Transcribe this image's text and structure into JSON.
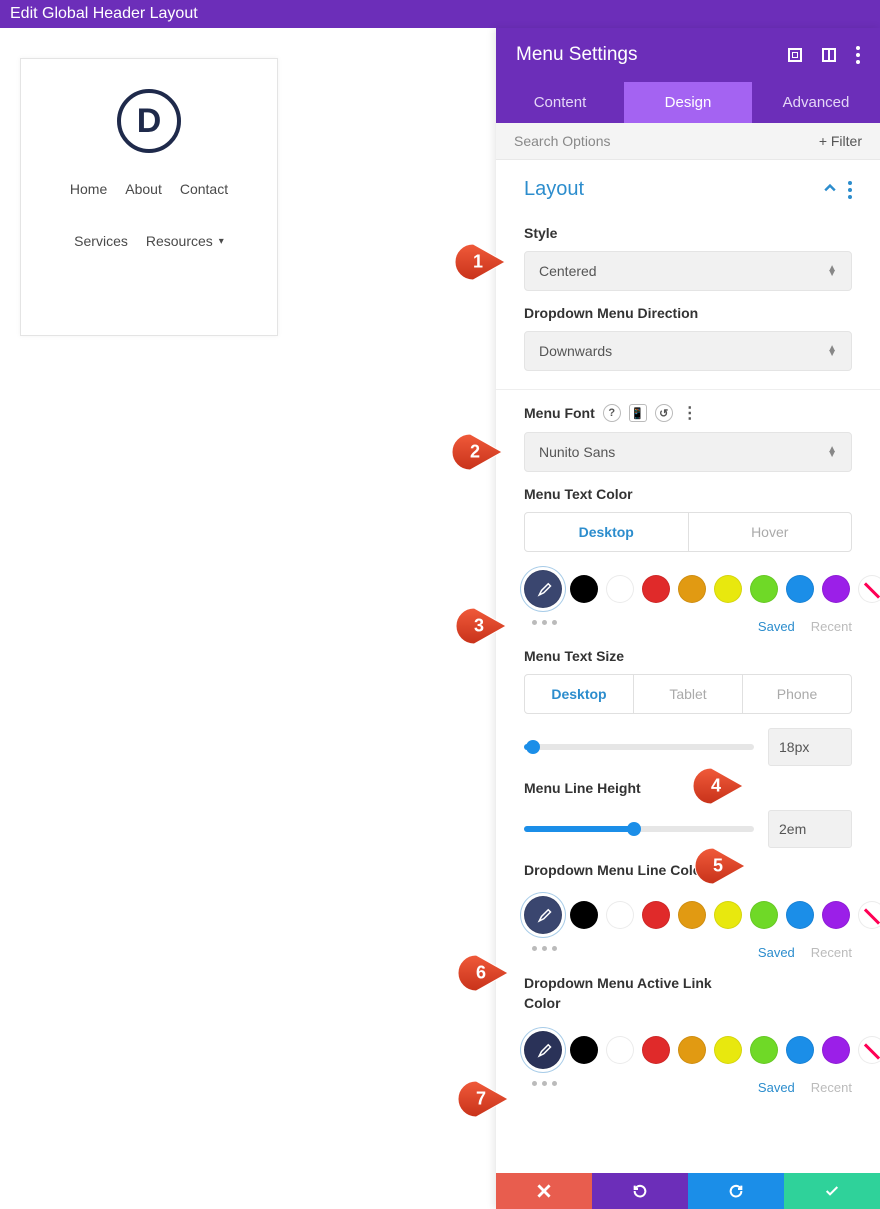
{
  "topbar": {
    "title": "Edit Global Header Layout"
  },
  "preview": {
    "logo_letter": "D",
    "menu": [
      "Home",
      "About",
      "Contact",
      "Services",
      "Resources"
    ]
  },
  "panel": {
    "title": "Menu Settings",
    "tabs": {
      "content": "Content",
      "design": "Design",
      "advanced": "Advanced"
    },
    "filter": {
      "search": "Search Options",
      "btn": "+  Filter"
    },
    "layout": {
      "title": "Layout",
      "style_label": "Style",
      "style_value": "Centered",
      "dir_label": "Dropdown Menu Direction",
      "dir_value": "Downwards"
    },
    "font": {
      "label": "Menu Font",
      "value": "Nunito Sans"
    },
    "text_color": {
      "label": "Menu Text Color",
      "tabs": {
        "desktop": "Desktop",
        "hover": "Hover"
      },
      "saved": "Saved",
      "recent": "Recent"
    },
    "text_size": {
      "label": "Menu Text Size",
      "tabs": {
        "desktop": "Desktop",
        "tablet": "Tablet",
        "phone": "Phone"
      },
      "value": "18px",
      "pct": 4
    },
    "line_height": {
      "label": "Menu Line Height",
      "value": "2em",
      "pct": 48
    },
    "dd_line": {
      "label": "Dropdown Menu Line Color",
      "saved": "Saved",
      "recent": "Recent"
    },
    "dd_active": {
      "label": "Dropdown Menu Active Link Color",
      "saved": "Saved",
      "recent": "Recent"
    },
    "swatch_colors": {
      "picker": "#3a466f",
      "picker_dark": "#2a3258",
      "list": [
        "#000000",
        "#ffffff",
        "#e02a2a",
        "#e19a12",
        "#e8e80e",
        "#6fd927",
        "#1b8ee8",
        "#9b1fe8"
      ]
    }
  },
  "callouts": [
    "1",
    "2",
    "3",
    "4",
    "5",
    "6",
    "7"
  ]
}
